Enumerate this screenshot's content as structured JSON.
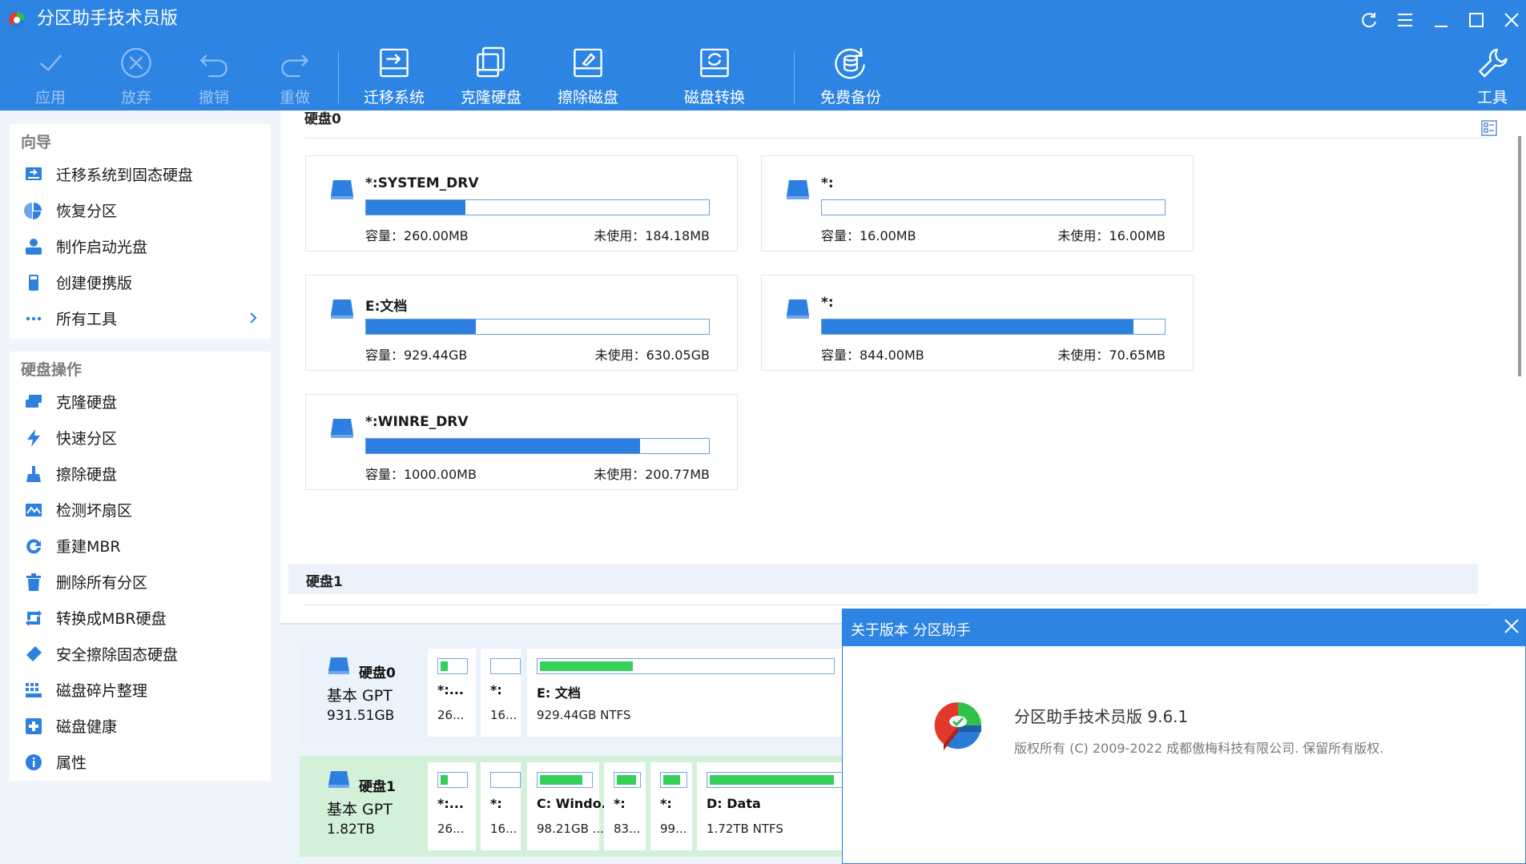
{
  "window": {
    "title": "分区助手技术员版"
  },
  "toolbar": {
    "apply": "应用",
    "discard": "放弃",
    "undo": "撤销",
    "redo": "重做",
    "migrate": "迁移系统",
    "clone": "克隆硬盘",
    "wipe": "擦除磁盘",
    "convert": "磁盘转换",
    "backup": "免费备份",
    "tools": "工具"
  },
  "sidebar": {
    "wizard_heading": "向导",
    "wizard_items": [
      {
        "label": "迁移系统到固态硬盘",
        "icon": "migrate-icon"
      },
      {
        "label": "恢复分区",
        "icon": "restore-icon"
      },
      {
        "label": "制作启动光盘",
        "icon": "bootable-disc-icon"
      },
      {
        "label": "创建便携版",
        "icon": "portable-icon"
      },
      {
        "label": "所有工具",
        "icon": "more-icon"
      }
    ],
    "disk_ops_heading": "硬盘操作",
    "disk_items": [
      {
        "label": "克隆硬盘",
        "icon": "clone-icon"
      },
      {
        "label": "快速分区",
        "icon": "lightning-icon"
      },
      {
        "label": "擦除硬盘",
        "icon": "wipe-icon"
      },
      {
        "label": "检测坏扇区",
        "icon": "surface-test-icon"
      },
      {
        "label": "重建MBR",
        "icon": "rebuild-icon"
      },
      {
        "label": "删除所有分区",
        "icon": "trash-icon"
      },
      {
        "label": "转换成MBR硬盘",
        "icon": "convert-icon"
      },
      {
        "label": "安全擦除固态硬盘",
        "icon": "eraser-icon"
      },
      {
        "label": "磁盘碎片整理",
        "icon": "defrag-icon"
      },
      {
        "label": "磁盘健康",
        "icon": "health-icon"
      },
      {
        "label": "属性",
        "icon": "info-icon"
      }
    ]
  },
  "main": {
    "disk0_header": "硬盘0",
    "disk1_header": "硬盘1",
    "partitions": [
      {
        "name": "*:SYSTEM_DRV",
        "capacity": "容量：260.00MB",
        "free": "未使用：184.18MB",
        "used_fraction": 0.29
      },
      {
        "name": "*:",
        "capacity": "容量：16.00MB",
        "free": "未使用：16.00MB",
        "used_fraction": 0.0
      },
      {
        "name": "E:文档",
        "capacity": "容量：929.44GB",
        "free": "未使用：630.05GB",
        "used_fraction": 0.32
      },
      {
        "name": "*:",
        "capacity": "容量：844.00MB",
        "free": "未使用：70.65MB",
        "used_fraction": 0.91
      },
      {
        "name": "*:WINRE_DRV",
        "capacity": "容量：1000.00MB",
        "free": "未使用：200.77MB",
        "used_fraction": 0.8
      }
    ]
  },
  "diskmap": {
    "disks": [
      {
        "name": "硬盘0",
        "type": "基本 GPT",
        "size": "931.51GB",
        "blocks": [
          {
            "name": "*:...",
            "info": "26...",
            "used_fraction": 0.29
          },
          {
            "name": "*:",
            "info": "16...",
            "used_fraction": 0.0
          },
          {
            "name": "E: 文档",
            "info": "929.44GB NTFS",
            "used_fraction": 0.32
          }
        ]
      },
      {
        "name": "硬盘1",
        "type": "基本 GPT",
        "size": "1.82TB",
        "blocks": [
          {
            "name": "*:...",
            "info": "26...",
            "used_fraction": 0.29
          },
          {
            "name": "*:",
            "info": "16...",
            "used_fraction": 0.0
          },
          {
            "name": "C: Windo...",
            "info": "98.21GB ...",
            "used_fraction": 0.85
          },
          {
            "name": "*:",
            "info": "83...",
            "used_fraction": 0.92
          },
          {
            "name": "*:",
            "info": "99...",
            "used_fraction": 0.8
          },
          {
            "name": "D: Data",
            "info": "1.72TB NTFS",
            "used_fraction": 0.9
          }
        ]
      }
    ]
  },
  "about": {
    "title": "关于版本 分区助手",
    "product": "分区助手技术员版 9.6.1",
    "copyright": "版权所有 (C) 2009-2022 成都傲梅科技有限公司. 保留所有版权."
  },
  "colors": {
    "brand_blue": "#2d84e3",
    "used_blue": "#2d7fe0",
    "used_green": "#35d05a"
  }
}
